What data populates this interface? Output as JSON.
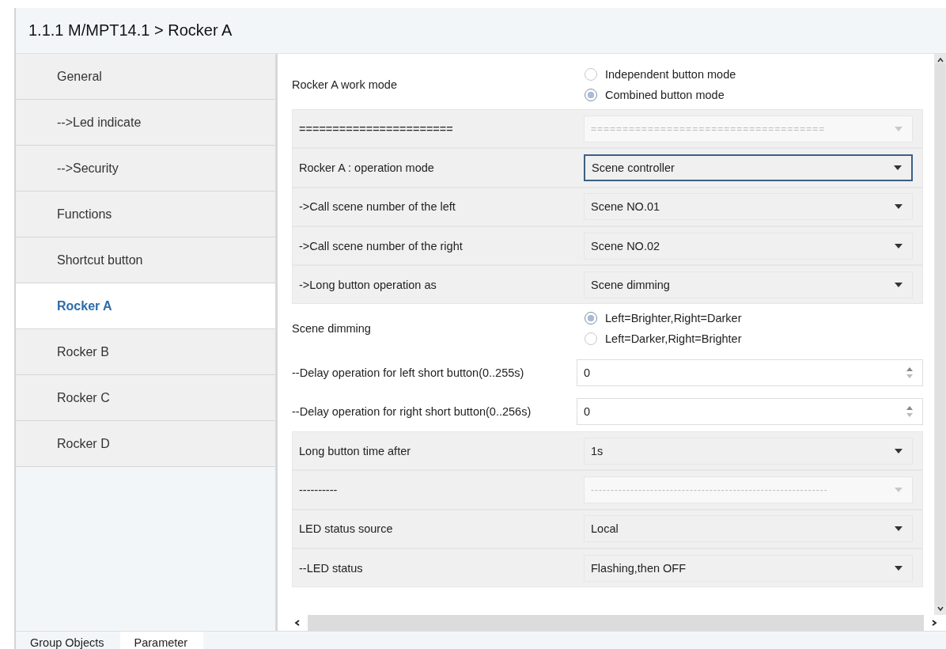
{
  "header": {
    "title": "1.1.1 M/MPT14.1 > Rocker A"
  },
  "sidebar": {
    "items": [
      {
        "label": "General",
        "selected": false
      },
      {
        "label": "-->Led indicate",
        "selected": false
      },
      {
        "label": "-->Security",
        "selected": false
      },
      {
        "label": "Functions",
        "selected": false
      },
      {
        "label": "Shortcut button",
        "selected": false
      },
      {
        "label": "Rocker A",
        "selected": true
      },
      {
        "label": "Rocker B",
        "selected": false
      },
      {
        "label": "Rocker C",
        "selected": false
      },
      {
        "label": "Rocker D",
        "selected": false
      }
    ]
  },
  "parameters": [
    {
      "kind": "radio",
      "label": "Rocker A work mode",
      "options": [
        {
          "label": "Independent button mode",
          "selected": false
        },
        {
          "label": "Combined button mode",
          "selected": true
        }
      ]
    },
    {
      "kind": "select",
      "label": "=======================",
      "value": "=====================================",
      "disabled": true,
      "focused": false
    },
    {
      "kind": "select",
      "label": "Rocker A : operation mode",
      "value": "Scene controller",
      "disabled": false,
      "focused": true
    },
    {
      "kind": "select",
      "label": "->Call scene number of the left",
      "value": "Scene NO.01",
      "disabled": false,
      "focused": false
    },
    {
      "kind": "select",
      "label": "->Call scene number of the right",
      "value": "Scene NO.02",
      "disabled": false,
      "focused": false
    },
    {
      "kind": "select",
      "label": "->Long button operation as",
      "value": "Scene dimming",
      "disabled": false,
      "focused": false
    },
    {
      "kind": "radio",
      "label": "Scene dimming",
      "options": [
        {
          "label": "Left=Brighter,Right=Darker",
          "selected": true
        },
        {
          "label": "Left=Darker,Right=Brighter",
          "selected": false
        }
      ]
    },
    {
      "kind": "number",
      "label": "--Delay operation for left short button(0..255s)",
      "value": "0"
    },
    {
      "kind": "number",
      "label": "--Delay operation for right short button(0..256s)",
      "value": "0"
    },
    {
      "kind": "select",
      "label": "Long button time after",
      "value": "1s",
      "disabled": false,
      "focused": false
    },
    {
      "kind": "select",
      "label": "----------",
      "value": "------------------------------------------------------------",
      "disabled": true,
      "focused": false
    },
    {
      "kind": "select",
      "label": "LED status source",
      "value": "Local",
      "disabled": false,
      "focused": false
    },
    {
      "kind": "select",
      "label": "--LED status",
      "value": "Flashing,then OFF",
      "disabled": false,
      "focused": false
    }
  ],
  "bottom_tabs": [
    {
      "label": "Group Objects",
      "selected": false
    },
    {
      "label": "Parameter",
      "selected": true
    }
  ]
}
